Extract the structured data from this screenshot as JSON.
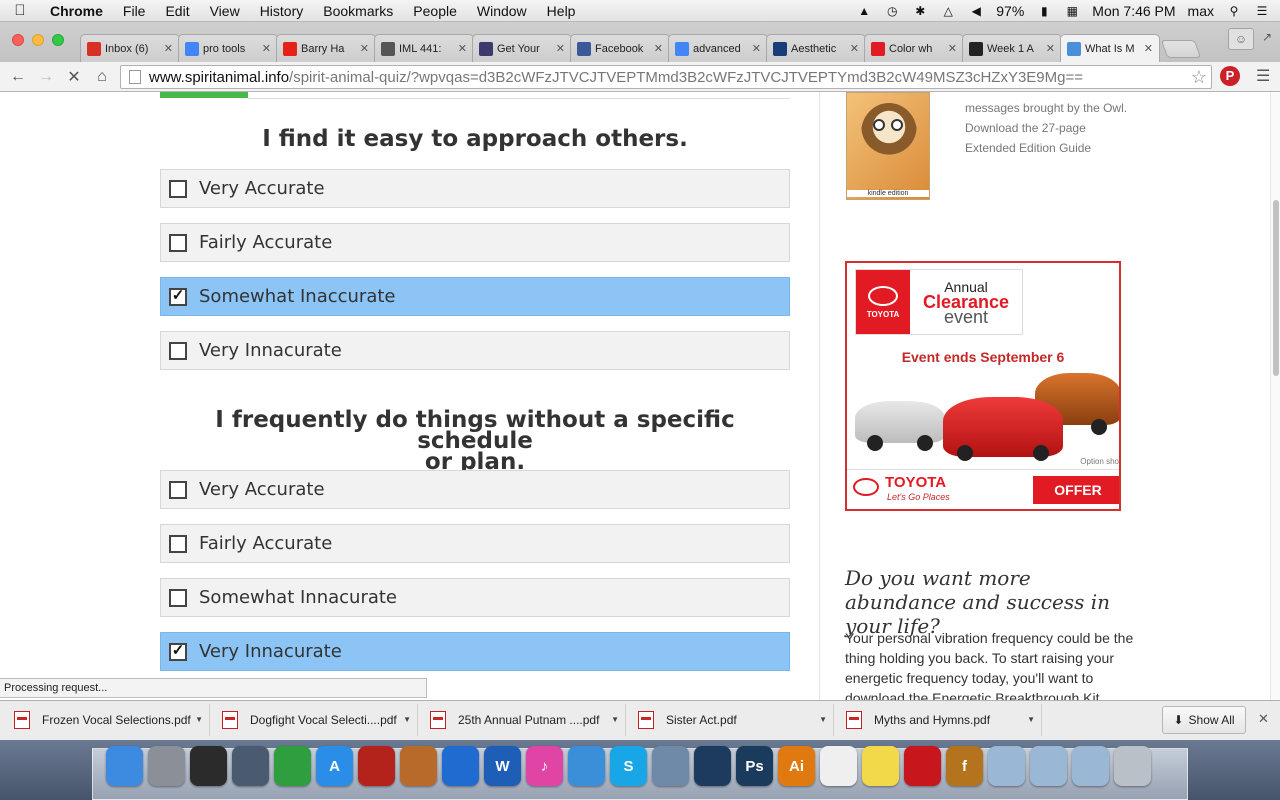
{
  "menubar": {
    "app": "Chrome",
    "items": [
      "File",
      "Edit",
      "View",
      "History",
      "Bookmarks",
      "People",
      "Window",
      "Help"
    ],
    "battery": "97%",
    "clock": "Mon 7:46 PM",
    "user": "max"
  },
  "tabs": [
    {
      "label": "Inbox (6)",
      "icon": "gmail-icon",
      "color": "#d93025"
    },
    {
      "label": "pro tools",
      "icon": "google-icon",
      "color": "#4285f4"
    },
    {
      "label": "Barry Ha",
      "icon": "youtube-icon",
      "color": "#e62117"
    },
    {
      "label": "IML 441:",
      "icon": "iml-icon",
      "color": "#555555"
    },
    {
      "label": "Get Your",
      "icon": "flag-icon",
      "color": "#3c3b6e"
    },
    {
      "label": "Facebook",
      "icon": "facebook-icon",
      "color": "#3b5998"
    },
    {
      "label": "advanced",
      "icon": "google-icon",
      "color": "#4285f4"
    },
    {
      "label": "Aesthetic",
      "icon": "iol-icon",
      "color": "#1a3c7a"
    },
    {
      "label": "Color wh",
      "icon": "adobe-icon",
      "color": "#e21a23"
    },
    {
      "label": "Week 1 A",
      "icon": "github-icon",
      "color": "#222222"
    },
    {
      "label": "What Is M",
      "icon": "loading-icon",
      "color": "#4a90d9"
    }
  ],
  "toolbar": {
    "url_domain": "www.spiritanimal.info",
    "url_path": "/spirit-animal-quiz/?wpvqas=d3B2cWFzJTVCJTVEPTMmd3B2cWFzJTVCJTVEPTYmd3B2cW49MSZ3cHZxY3E9Mg=="
  },
  "quiz": {
    "questions": [
      {
        "title": "I find it easy to approach others.",
        "options": [
          {
            "label": "Very Accurate",
            "checked": false
          },
          {
            "label": "Fairly Accurate",
            "checked": false
          },
          {
            "label": "Somewhat Inaccurate",
            "checked": true
          },
          {
            "label": "Very Innacurate",
            "checked": false
          }
        ]
      },
      {
        "title_line1": "I frequently do things without a specific schedule",
        "title_line2": "or plan.",
        "options": [
          {
            "label": "Very Accurate",
            "checked": false
          },
          {
            "label": "Fairly Accurate",
            "checked": false
          },
          {
            "label": "Somewhat Innacurate",
            "checked": false
          },
          {
            "label": "Very Innacurate",
            "checked": true
          }
        ]
      }
    ]
  },
  "status": "Processing request...",
  "sidebar": {
    "book_text": "messages brought by the Owl. Download the 27-page Extended Edition Guide",
    "book_badge": "kindle edition",
    "ad": {
      "brand_small": "TOYOTA",
      "event_line1": "Annual",
      "event_line2": "Clearance",
      "event_line3": "event",
      "ends": "Event ends September 6",
      "option_shown": "Option sho",
      "footer_brand": "TOYOTA",
      "tagline": "Let's Go Places",
      "cta": "OFFER DETAIL"
    },
    "promo_title": "Do you want more abundance and success in your life?",
    "promo_text": "Your personal vibration frequency could be the thing holding you back. To start raising your energetic frequency today, you'll want to download the Energetic Breakthrough Kit"
  },
  "downloads": {
    "items": [
      "Frozen Vocal Selections.pdf",
      "Dogfight Vocal Selecti....pdf",
      "25th Annual Putnam ....pdf",
      "Sister Act.pdf",
      "Myths and Hymns.pdf"
    ],
    "show_all": "Show All"
  },
  "dock": [
    {
      "name": "finder-icon",
      "color": "#3d8be0",
      "glyph": ""
    },
    {
      "name": "launchpad-icon",
      "color": "#8a8f98",
      "glyph": ""
    },
    {
      "name": "dashboard-icon",
      "color": "#2b2b2b",
      "glyph": ""
    },
    {
      "name": "mission-control-icon",
      "color": "#4a5b70",
      "glyph": ""
    },
    {
      "name": "chrome-icon",
      "color": "#2e9e3f",
      "glyph": ""
    },
    {
      "name": "app-store-icon",
      "color": "#2a8ee8",
      "glyph": "A"
    },
    {
      "name": "photo-booth-icon",
      "color": "#b3221b",
      "glyph": ""
    },
    {
      "name": "garageband-icon",
      "color": "#b86a2b",
      "glyph": ""
    },
    {
      "name": "google-earth-icon",
      "color": "#1f6bcf",
      "glyph": ""
    },
    {
      "name": "word-icon",
      "color": "#1e5eb7",
      "glyph": "W"
    },
    {
      "name": "itunes-icon",
      "color": "#e044a4",
      "glyph": "♪"
    },
    {
      "name": "safari-icon",
      "color": "#3b8fd9",
      "glyph": ""
    },
    {
      "name": "skype-icon",
      "color": "#19a6e6",
      "glyph": "S"
    },
    {
      "name": "iphoto-icon",
      "color": "#6f8aa8",
      "glyph": ""
    },
    {
      "name": "time-machine-icon",
      "color": "#1c3b5e",
      "glyph": ""
    },
    {
      "name": "photoshop-icon",
      "color": "#1a3b5c",
      "glyph": "Ps"
    },
    {
      "name": "illustrator-icon",
      "color": "#e07a10",
      "glyph": "Ai"
    },
    {
      "name": "reminders-icon",
      "color": "#efefef",
      "glyph": ""
    },
    {
      "name": "stickies-icon",
      "color": "#f2d94a",
      "glyph": ""
    },
    {
      "name": "acrobat-icon",
      "color": "#c8161d",
      "glyph": ""
    },
    {
      "name": "fontbook-icon",
      "color": "#b3741d",
      "glyph": "f"
    },
    {
      "name": "downloads-folder-icon",
      "color": "#9ab7d6",
      "glyph": ""
    },
    {
      "name": "applications-folder-icon",
      "color": "#9ab7d6",
      "glyph": ""
    },
    {
      "name": "documents-folder-icon",
      "color": "#9ab7d6",
      "glyph": ""
    },
    {
      "name": "trash-icon",
      "color": "#b9c0c8",
      "glyph": ""
    }
  ]
}
